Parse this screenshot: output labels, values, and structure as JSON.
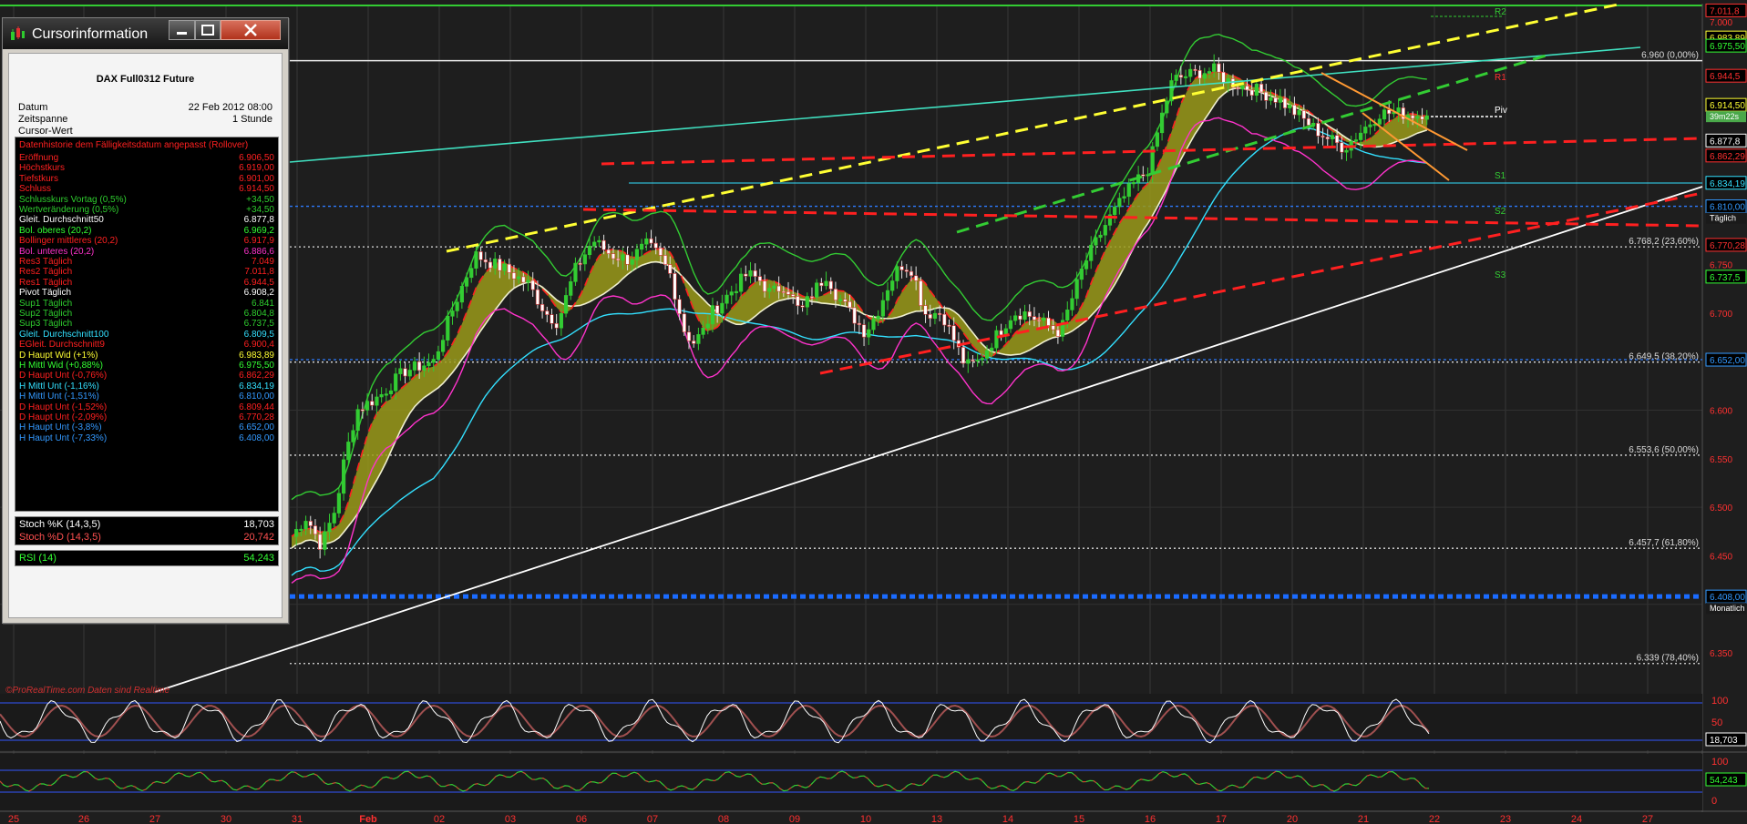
{
  "panel": {
    "title": "Cursorinformation",
    "instrument": "DAX Full0312 Future",
    "meta": [
      {
        "label": "Datum",
        "value": "22 Feb 2012 08:00"
      },
      {
        "label": "Zeitspanne",
        "value": "1 Stunde"
      },
      {
        "label": "Cursor-Wert",
        "value": ""
      }
    ],
    "history_header": "Datenhistorie dem Fälligkeitsdatum angepasst (Rollover)",
    "rows": [
      {
        "label": "Eröffnung",
        "value": "6.906,50",
        "color": "#ff2020"
      },
      {
        "label": "Höchstkurs",
        "value": "6.919,00",
        "color": "#ff2020"
      },
      {
        "label": "Tiefstkurs",
        "value": "6.901,00",
        "color": "#ff2020"
      },
      {
        "label": "Schluss",
        "value": "6.914,50",
        "color": "#ff2020"
      },
      {
        "label": "Schlusskurs Vortag (0,5%)",
        "value": "+34,50",
        "color": "#2ecc2e"
      },
      {
        "label": "Wertveränderung (0,5%)",
        "value": "+34,50",
        "color": "#2ecc2e"
      },
      {
        "label": "Gleit. Durchschnitt50",
        "value": "6.877,8",
        "color": "#ffffff"
      },
      {
        "label": "Bol. oberes (20,2)",
        "value": "6.969,2",
        "color": "#33ff33"
      },
      {
        "label": "Bollinger mittleres (20,2)",
        "value": "6.917,9",
        "color": "#ff2020"
      },
      {
        "label": "Bol. unteres (20,2)",
        "value": "6.886,6",
        "color": "#ff33cc"
      },
      {
        "label": "Res3 Täglich",
        "value": "7.049",
        "color": "#ff2020"
      },
      {
        "label": "Res2 Täglich",
        "value": "7.011,8",
        "color": "#ff2020"
      },
      {
        "label": "Res1 Täglich",
        "value": "6.944,5",
        "color": "#ff2020"
      },
      {
        "label": "Pivot Täglich",
        "value": "6.908,2",
        "color": "#ffffff"
      },
      {
        "label": "Sup1 Täglich",
        "value": "6.841",
        "color": "#2ecc2e"
      },
      {
        "label": "Sup2 Täglich",
        "value": "6.804,8",
        "color": "#2ecc2e"
      },
      {
        "label": "Sup3 Täglich",
        "value": "6.737,5",
        "color": "#2ecc2e"
      },
      {
        "label": "Gleit. Durchschnitt100",
        "value": "6.809,5",
        "color": "#33e0ff"
      },
      {
        "label": "EGleit. Durchschnitt9",
        "value": "6.900,4",
        "color": "#ff2020"
      },
      {
        "label": "D Haupt Wid (+1%)",
        "value": "6.983,89",
        "color": "#ffff33"
      },
      {
        "label": "H Mittl Wid (+0,88%)",
        "value": "6.975,50",
        "color": "#33ff33"
      },
      {
        "label": "D Haupt Unt (-0,76%)",
        "value": "6.862,29",
        "color": "#ff2020"
      },
      {
        "label": "H Mittl Unt (-1,16%)",
        "value": "6.834,19",
        "color": "#33e0ff"
      },
      {
        "label": "H Mittl Unt (-1,51%)",
        "value": "6.810,00",
        "color": "#3399ff"
      },
      {
        "label": "D Haupt Unt (-1,52%)",
        "value": "6.809,44",
        "color": "#ff2020"
      },
      {
        "label": "D Haupt Unt (-2,09%)",
        "value": "6.770,28",
        "color": "#ff2020"
      },
      {
        "label": "H Haupt Unt (-3,8%)",
        "value": "6.652,00",
        "color": "#3399ff"
      },
      {
        "label": "H Haupt Unt (-7,33%)",
        "value": "6.408,00",
        "color": "#3399ff"
      }
    ],
    "stoch": [
      {
        "label": "Stoch %K (14,3,5)",
        "value": "18,703",
        "color": "#ffffff"
      },
      {
        "label": "Stoch %D (14,3,5)",
        "value": "20,742",
        "color": "#ff5050"
      }
    ],
    "rsi": {
      "label": "RSI (14)",
      "value": "54,243",
      "color": "#33ff33"
    }
  },
  "chart": {
    "source": "©ProRealTime.com   Daten sind Realtime",
    "price_labels": [
      {
        "price": 7011.8,
        "text": "7.011,8",
        "color": "#ff3030",
        "boxed": true
      },
      {
        "price": 7000,
        "text": "7.000",
        "color": "#ff3030",
        "boxed": false
      },
      {
        "price": 6983.89,
        "text": "6.983,89",
        "color": "#ffff33",
        "boxed": true
      },
      {
        "price": 6975.5,
        "text": "6.975,50",
        "color": "#33ff33",
        "boxed": true
      },
      {
        "price": 6944.5,
        "text": "6.944,5",
        "color": "#ff3030",
        "boxed": true
      },
      {
        "price": 6914.5,
        "text": "6.914,50",
        "color": "#ffff33",
        "boxed": true,
        "sub": "39m22s"
      },
      {
        "price": 6877.8,
        "text": "6.877,8",
        "color": "#ffffff",
        "boxed": true
      },
      {
        "price": 6862.29,
        "text": "6.862,29",
        "color": "#ff3030",
        "boxed": true
      },
      {
        "price": 6834.19,
        "text": "6.834,19",
        "color": "#33e0ff",
        "boxed": true
      },
      {
        "price": 6810,
        "text": "6.810,00",
        "color": "#3399ff",
        "boxed": true,
        "sub": "Täglich"
      },
      {
        "price": 6770.28,
        "text": "6.770,28",
        "color": "#ff3030",
        "boxed": true
      },
      {
        "price": 6750,
        "text": "6.750",
        "color": "#ff3030",
        "boxed": false
      },
      {
        "price": 6737.5,
        "text": "6.737,5",
        "color": "#33ff33",
        "boxed": true
      },
      {
        "price": 6700,
        "text": "6.700",
        "color": "#ff3030",
        "boxed": false
      },
      {
        "price": 6652,
        "text": "6.652,00",
        "color": "#3399ff",
        "boxed": true
      },
      {
        "price": 6600,
        "text": "6.600",
        "color": "#ff3030",
        "boxed": false
      },
      {
        "price": 6550,
        "text": "6.550",
        "color": "#ff3030",
        "boxed": false
      },
      {
        "price": 6500,
        "text": "6.500",
        "color": "#ff3030",
        "boxed": false
      },
      {
        "price": 6450,
        "text": "6.450",
        "color": "#ff3030",
        "boxed": false
      },
      {
        "price": 6408,
        "text": "6.408,00",
        "color": "#3399ff",
        "boxed": true,
        "sub": "Monatlich"
      },
      {
        "price": 6350,
        "text": "6.350",
        "color": "#ff3030",
        "boxed": false
      }
    ],
    "fib_levels": [
      {
        "price": 6960,
        "text": "6.960 (0,00%)"
      },
      {
        "price": 6768.2,
        "text": "6.768,2 (23,60%)"
      },
      {
        "price": 6649.5,
        "text": "6.649,5 (38,20%)"
      },
      {
        "price": 6553.6,
        "text": "6.553,6 (50,00%)"
      },
      {
        "price": 6457.7,
        "text": "6.457,7 (61,80%)"
      },
      {
        "price": 6339,
        "text": "6.339 (78,40%)"
      }
    ],
    "pivot_markers": [
      "R2",
      "R1",
      "Piv",
      "S1",
      "S2",
      "S3"
    ],
    "x_labels": [
      "25",
      "26",
      "27",
      "30",
      "31",
      "Feb",
      "02",
      "03",
      "06",
      "07",
      "08",
      "09",
      "10",
      "13",
      "14",
      "15",
      "16",
      "17",
      "20",
      "21",
      "22",
      "23",
      "24",
      "27"
    ],
    "stoch_axis": [
      "100",
      "50",
      "0"
    ],
    "stoch_value": "18,703",
    "rsi_axis": [
      "100",
      "0"
    ],
    "rsi_value": "54,243"
  }
}
